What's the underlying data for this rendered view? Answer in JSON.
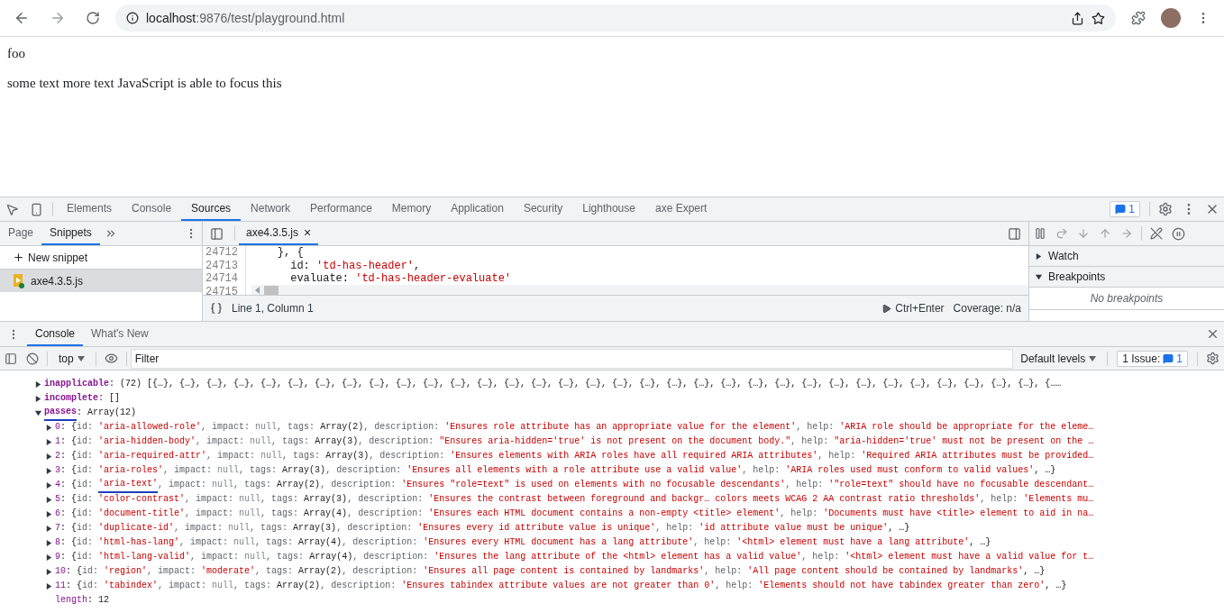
{
  "browser": {
    "address_host": "localhost",
    "address_path": ":9876/test/playground.html",
    "forward_disabled": true
  },
  "page": {
    "heading": "foo",
    "paragraph": "some text more text JavaScript is able to focus this"
  },
  "devtools": {
    "tabs": [
      {
        "label": "Elements",
        "selected": false
      },
      {
        "label": "Console",
        "selected": false
      },
      {
        "label": "Sources",
        "selected": true
      },
      {
        "label": "Network",
        "selected": false
      },
      {
        "label": "Performance",
        "selected": false
      },
      {
        "label": "Memory",
        "selected": false
      },
      {
        "label": "Application",
        "selected": false
      },
      {
        "label": "Security",
        "selected": false
      },
      {
        "label": "Lighthouse",
        "selected": false
      },
      {
        "label": "axe Expert",
        "selected": false
      }
    ],
    "issues_count": "1",
    "navigator": {
      "tabs": [
        {
          "label": "Page",
          "selected": false
        },
        {
          "label": "Snippets",
          "selected": true
        }
      ],
      "new_snippet": "New snippet",
      "files": [
        {
          "name": "axe4.3.5.js",
          "selected": true
        }
      ]
    },
    "editor": {
      "tab": "axe4.3.5.js",
      "close": "×",
      "lines": [
        {
          "number": "24712",
          "parts": [
            {
              "kind": "p",
              "text": "    }, {"
            }
          ]
        },
        {
          "number": "24713",
          "parts": [
            {
              "kind": "p",
              "text": "      id: "
            },
            {
              "kind": "s",
              "text": "'td-has-header'"
            },
            {
              "kind": "p",
              "text": ","
            }
          ]
        },
        {
          "number": "24714",
          "parts": [
            {
              "kind": "p",
              "text": "      evaluate: "
            },
            {
              "kind": "s",
              "text": "'td-has-header-evaluate'"
            }
          ]
        },
        {
          "number": "24715"
        }
      ],
      "position": "Line 1, Column 1",
      "run": "Ctrl+Enter",
      "coverage": "Coverage: n/a"
    },
    "sidebar": {
      "sections": [
        {
          "label": "Watch",
          "expanded": false
        },
        {
          "label": "Breakpoints",
          "expanded": true,
          "empty_text": "No breakpoints"
        }
      ]
    },
    "drawer": {
      "tabs": [
        {
          "label": "Console",
          "selected": true
        },
        {
          "label": "What's New",
          "selected": false
        }
      ],
      "context": "top",
      "filter_placeholder": "Filter",
      "levels": "Default levels",
      "issues_label": "1 Issue:",
      "issues_count": "1",
      "output": [
        {
          "kind": "collapsed",
          "key": "inapplicable",
          "parts": [
            {
              "kind": "p",
              "text": ": "
            },
            {
              "kind": "p",
              "text": "(72) [{…}, {…}, {…}, {…}, {…}, {…}, {…}, {…}, {…}, {…}, {…}, {…}, {…}, {…}, {…}, {…}, {…}, {…}, {…}, {…}, {…}, {…}, {…}, {…}, {…}, {…}, {…}, {…}, {…}, {…}, {…}, {…}, {…}, {……"
            }
          ]
        },
        {
          "kind": "collapsed",
          "key": "incomplete",
          "parts": [
            {
              "kind": "p",
              "text": ": "
            },
            {
              "kind": "p",
              "text": "[]"
            }
          ]
        },
        {
          "kind": "expanded",
          "key": "passes",
          "underlined": true,
          "parts": [
            {
              "kind": "p",
              "text": ": "
            },
            {
              "kind": "p",
              "text": "Array(12)"
            }
          ],
          "children": [
            {
              "index": "0",
              "parts": [
                {
                  "kind": "p",
                  "text": ": {"
                },
                {
                  "kind": "k",
                  "text": "id: "
                },
                {
                  "kind": "s",
                  "text": "'aria-allowed-role'"
                },
                {
                  "kind": "k",
                  "text": ", impact: "
                },
                {
                  "kind": "n",
                  "text": "null"
                },
                {
                  "kind": "k",
                  "text": ", tags: "
                },
                {
                  "kind": "p",
                  "text": "Array(2)"
                },
                {
                  "kind": "k",
                  "text": ", description: "
                },
                {
                  "kind": "s",
                  "text": "'Ensures role attribute has an appropriate value for the element'"
                },
                {
                  "kind": "k",
                  "text": ", help: "
                },
                {
                  "kind": "s",
                  "text": "'ARIA role should be appropriate for the eleme…"
                }
              ]
            },
            {
              "index": "1",
              "parts": [
                {
                  "kind": "p",
                  "text": ": {"
                },
                {
                  "kind": "k",
                  "text": "id: "
                },
                {
                  "kind": "s",
                  "text": "'aria-hidden-body'"
                },
                {
                  "kind": "k",
                  "text": ", impact: "
                },
                {
                  "kind": "n",
                  "text": "null"
                },
                {
                  "kind": "k",
                  "text": ", tags: "
                },
                {
                  "kind": "p",
                  "text": "Array(3)"
                },
                {
                  "kind": "k",
                  "text": ", description: "
                },
                {
                  "kind": "s",
                  "text": "\"Ensures aria-hidden='true' is not present on the document body.\""
                },
                {
                  "kind": "k",
                  "text": ", help: "
                },
                {
                  "kind": "s",
                  "text": "\"aria-hidden='true' must not be present on the …"
                }
              ]
            },
            {
              "index": "2",
              "parts": [
                {
                  "kind": "p",
                  "text": ": {"
                },
                {
                  "kind": "k",
                  "text": "id: "
                },
                {
                  "kind": "s",
                  "text": "'aria-required-attr'"
                },
                {
                  "kind": "k",
                  "text": ", impact: "
                },
                {
                  "kind": "n",
                  "text": "null"
                },
                {
                  "kind": "k",
                  "text": ", tags: "
                },
                {
                  "kind": "p",
                  "text": "Array(3)"
                },
                {
                  "kind": "k",
                  "text": ", description: "
                },
                {
                  "kind": "s",
                  "text": "'Ensures elements with ARIA roles have all required ARIA attributes'"
                },
                {
                  "kind": "k",
                  "text": ", help: "
                },
                {
                  "kind": "s",
                  "text": "'Required ARIA attributes must be provided…"
                }
              ]
            },
            {
              "index": "3",
              "parts": [
                {
                  "kind": "p",
                  "text": ": {"
                },
                {
                  "kind": "k",
                  "text": "id: "
                },
                {
                  "kind": "s",
                  "text": "'aria-roles'"
                },
                {
                  "kind": "k",
                  "text": ", impact: "
                },
                {
                  "kind": "n",
                  "text": "null"
                },
                {
                  "kind": "k",
                  "text": ", tags: "
                },
                {
                  "kind": "p",
                  "text": "Array(3)"
                },
                {
                  "kind": "k",
                  "text": ", description: "
                },
                {
                  "kind": "s",
                  "text": "'Ensures all elements with a role attribute use a valid value'"
                },
                {
                  "kind": "k",
                  "text": ", help: "
                },
                {
                  "kind": "s",
                  "text": "'ARIA roles used must conform to valid values'"
                },
                {
                  "kind": "p",
                  "text": ", …}"
                }
              ]
            },
            {
              "index": "4",
              "parts": [
                {
                  "kind": "p",
                  "text": ": {"
                },
                {
                  "kind": "k",
                  "text": "id: "
                },
                {
                  "kind": "s",
                  "text": "'aria-text'",
                  "underlined": true
                },
                {
                  "kind": "k",
                  "text": ", impact: "
                },
                {
                  "kind": "n",
                  "text": "null"
                },
                {
                  "kind": "k",
                  "text": ", tags: "
                },
                {
                  "kind": "p",
                  "text": "Array(2)"
                },
                {
                  "kind": "k",
                  "text": ", description: "
                },
                {
                  "kind": "s",
                  "text": "'Ensures \"role=text\" is used on elements with no focusable descendants'"
                },
                {
                  "kind": "k",
                  "text": ", help: "
                },
                {
                  "kind": "s",
                  "text": "'\"role=text\" should have no focusable descendant…"
                }
              ]
            },
            {
              "index": "5",
              "parts": [
                {
                  "kind": "p",
                  "text": ": {"
                },
                {
                  "kind": "k",
                  "text": "id: "
                },
                {
                  "kind": "s",
                  "text": "'color-contrast'"
                },
                {
                  "kind": "k",
                  "text": ", impact: "
                },
                {
                  "kind": "n",
                  "text": "null"
                },
                {
                  "kind": "k",
                  "text": ", tags: "
                },
                {
                  "kind": "p",
                  "text": "Array(3)"
                },
                {
                  "kind": "k",
                  "text": ", description: "
                },
                {
                  "kind": "s",
                  "text": "'Ensures the contrast between foreground and backgr… colors meets WCAG 2 AA contrast ratio thresholds'"
                },
                {
                  "kind": "k",
                  "text": ", help: "
                },
                {
                  "kind": "s",
                  "text": "'Elements mu…"
                }
              ]
            },
            {
              "index": "6",
              "parts": [
                {
                  "kind": "p",
                  "text": ": {"
                },
                {
                  "kind": "k",
                  "text": "id: "
                },
                {
                  "kind": "s",
                  "text": "'document-title'"
                },
                {
                  "kind": "k",
                  "text": ", impact: "
                },
                {
                  "kind": "n",
                  "text": "null"
                },
                {
                  "kind": "k",
                  "text": ", tags: "
                },
                {
                  "kind": "p",
                  "text": "Array(4)"
                },
                {
                  "kind": "k",
                  "text": ", description: "
                },
                {
                  "kind": "s",
                  "text": "'Ensures each HTML document contains a non-empty <title> element'"
                },
                {
                  "kind": "k",
                  "text": ", help: "
                },
                {
                  "kind": "s",
                  "text": "'Documents must have <title> element to aid in na…"
                }
              ]
            },
            {
              "index": "7",
              "parts": [
                {
                  "kind": "p",
                  "text": ": {"
                },
                {
                  "kind": "k",
                  "text": "id: "
                },
                {
                  "kind": "s",
                  "text": "'duplicate-id'"
                },
                {
                  "kind": "k",
                  "text": ", impact: "
                },
                {
                  "kind": "n",
                  "text": "null"
                },
                {
                  "kind": "k",
                  "text": ", tags: "
                },
                {
                  "kind": "p",
                  "text": "Array(3)"
                },
                {
                  "kind": "k",
                  "text": ", description: "
                },
                {
                  "kind": "s",
                  "text": "'Ensures every id attribute value is unique'"
                },
                {
                  "kind": "k",
                  "text": ", help: "
                },
                {
                  "kind": "s",
                  "text": "'id attribute value must be unique'"
                },
                {
                  "kind": "p",
                  "text": ", …}"
                }
              ]
            },
            {
              "index": "8",
              "parts": [
                {
                  "kind": "p",
                  "text": ": {"
                },
                {
                  "kind": "k",
                  "text": "id: "
                },
                {
                  "kind": "s",
                  "text": "'html-has-lang'"
                },
                {
                  "kind": "k",
                  "text": ", impact: "
                },
                {
                  "kind": "n",
                  "text": "null"
                },
                {
                  "kind": "k",
                  "text": ", tags: "
                },
                {
                  "kind": "p",
                  "text": "Array(4)"
                },
                {
                  "kind": "k",
                  "text": ", description: "
                },
                {
                  "kind": "s",
                  "text": "'Ensures every HTML document has a lang attribute'"
                },
                {
                  "kind": "k",
                  "text": ", help: "
                },
                {
                  "kind": "s",
                  "text": "'<html> element must have a lang attribute'"
                },
                {
                  "kind": "p",
                  "text": ", …}"
                }
              ]
            },
            {
              "index": "9",
              "parts": [
                {
                  "kind": "p",
                  "text": ": {"
                },
                {
                  "kind": "k",
                  "text": "id: "
                },
                {
                  "kind": "s",
                  "text": "'html-lang-valid'"
                },
                {
                  "kind": "k",
                  "text": ", impact: "
                },
                {
                  "kind": "n",
                  "text": "null"
                },
                {
                  "kind": "k",
                  "text": ", tags: "
                },
                {
                  "kind": "p",
                  "text": "Array(4)"
                },
                {
                  "kind": "k",
                  "text": ", description: "
                },
                {
                  "kind": "s",
                  "text": "'Ensures the lang attribute of the <html> element has a valid value'"
                },
                {
                  "kind": "k",
                  "text": ", help: "
                },
                {
                  "kind": "s",
                  "text": "'<html> element must have a valid value for t…"
                }
              ]
            },
            {
              "index": "10",
              "parts": [
                {
                  "kind": "p",
                  "text": ": {"
                },
                {
                  "kind": "k",
                  "text": "id: "
                },
                {
                  "kind": "s",
                  "text": "'region'"
                },
                {
                  "kind": "k",
                  "text": ", impact: "
                },
                {
                  "kind": "s",
                  "text": "'moderate'"
                },
                {
                  "kind": "k",
                  "text": ", tags: "
                },
                {
                  "kind": "p",
                  "text": "Array(2)"
                },
                {
                  "kind": "k",
                  "text": ", description: "
                },
                {
                  "kind": "s",
                  "text": "'Ensures all page content is contained by landmarks'"
                },
                {
                  "kind": "k",
                  "text": ", help: "
                },
                {
                  "kind": "s",
                  "text": "'All page content should be contained by landmarks'"
                },
                {
                  "kind": "p",
                  "text": ", …}"
                }
              ]
            },
            {
              "index": "11",
              "parts": [
                {
                  "kind": "p",
                  "text": ": {"
                },
                {
                  "kind": "k",
                  "text": "id: "
                },
                {
                  "kind": "s",
                  "text": "'tabindex'"
                },
                {
                  "kind": "k",
                  "text": ", impact: "
                },
                {
                  "kind": "n",
                  "text": "null"
                },
                {
                  "kind": "k",
                  "text": ", tags: "
                },
                {
                  "kind": "p",
                  "text": "Array(2)"
                },
                {
                  "kind": "k",
                  "text": ", description: "
                },
                {
                  "kind": "s",
                  "text": "'Ensures tabindex attribute values are not greater than 0'"
                },
                {
                  "kind": "k",
                  "text": ", help: "
                },
                {
                  "kind": "s",
                  "text": "'Elements should not have tabindex greater than zero'"
                },
                {
                  "kind": "p",
                  "text": ", …}"
                }
              ]
            }
          ],
          "length_key": "length",
          "length_parts": [
            {
              "kind": "p",
              "text": ": 12"
            }
          ]
        }
      ]
    }
  }
}
